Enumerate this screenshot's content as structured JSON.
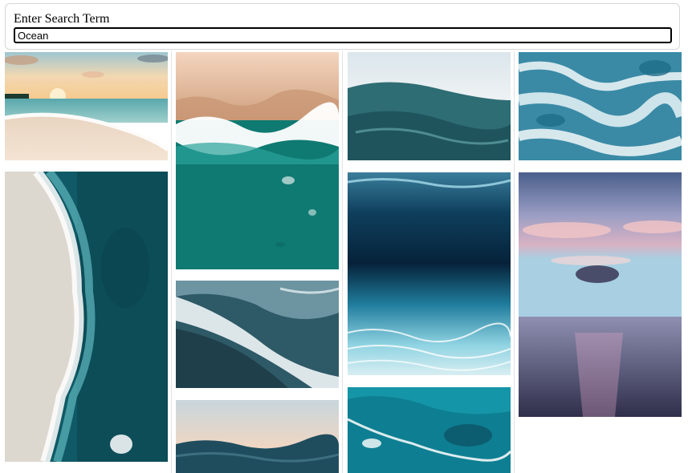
{
  "search": {
    "label": "Enter Search Term",
    "value": "Ocean"
  },
  "gallery": {
    "columns": 4,
    "images": [
      {
        "subject": "sunset beach with waves",
        "column": 1
      },
      {
        "subject": "aerial turquoise shoreline",
        "column": 1
      },
      {
        "subject": "aerial sand and teal water",
        "column": 2
      },
      {
        "subject": "crashing white surf",
        "column": 2
      },
      {
        "subject": "calm sea at dusk",
        "column": 2
      },
      {
        "subject": "dark blue ocean waves",
        "column": 3
      },
      {
        "subject": "underwater view with light rays",
        "column": 3
      },
      {
        "subject": "aerial turquoise reef water",
        "column": 3
      },
      {
        "subject": "white foamy sea surface",
        "column": 4
      },
      {
        "subject": "pink sky over calm sea with cloud",
        "column": 4
      }
    ]
  }
}
